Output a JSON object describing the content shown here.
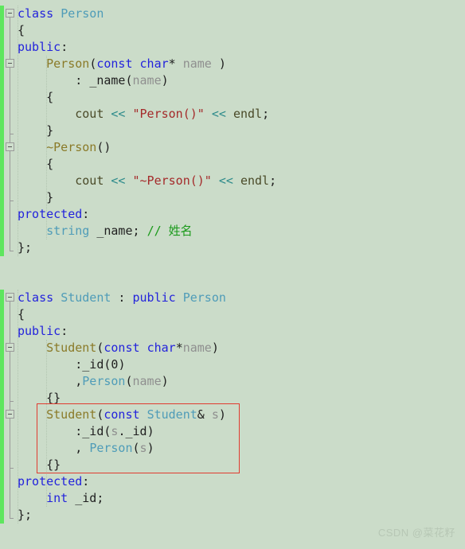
{
  "editor": {
    "background_color": "#cbdcc9",
    "change_bar_color": "#5ee65e",
    "annotation_box_color": "#e03b2f",
    "language": "C++"
  },
  "watermark": {
    "text": "CSDN @菜花籽"
  },
  "code": {
    "lines": [
      {
        "n": 1,
        "indent": 0,
        "tokens": [
          {
            "t": "class",
            "c": "kw"
          },
          {
            "t": " ",
            "c": "plain"
          },
          {
            "t": "Person",
            "c": "type"
          }
        ]
      },
      {
        "n": 2,
        "indent": 0,
        "tokens": [
          {
            "t": "{",
            "c": "plain"
          }
        ]
      },
      {
        "n": 3,
        "indent": 0,
        "tokens": [
          {
            "t": "public",
            "c": "kw"
          },
          {
            "t": ":",
            "c": "plain"
          }
        ]
      },
      {
        "n": 4,
        "indent": 0,
        "tokens": [
          {
            "t": "    ",
            "c": "plain"
          },
          {
            "t": "Person",
            "c": "fn"
          },
          {
            "t": "(",
            "c": "plain"
          },
          {
            "t": "const",
            "c": "kw"
          },
          {
            "t": " ",
            "c": "plain"
          },
          {
            "t": "char",
            "c": "kw"
          },
          {
            "t": "*",
            "c": "plain"
          },
          {
            "t": " ",
            "c": "plain"
          },
          {
            "t": "name",
            "c": "var"
          },
          {
            "t": " )",
            "c": "plain"
          }
        ]
      },
      {
        "n": 5,
        "indent": 0,
        "tokens": [
          {
            "t": "        : ",
            "c": "plain"
          },
          {
            "t": "_name",
            "c": "plain"
          },
          {
            "t": "(",
            "c": "plain"
          },
          {
            "t": "name",
            "c": "var"
          },
          {
            "t": ")",
            "c": "plain"
          }
        ]
      },
      {
        "n": 6,
        "indent": 0,
        "tokens": [
          {
            "t": "    {",
            "c": "plain"
          }
        ]
      },
      {
        "n": 7,
        "indent": 0,
        "tokens": [
          {
            "t": "        ",
            "c": "plain"
          },
          {
            "t": "cout",
            "c": "id"
          },
          {
            "t": " ",
            "c": "plain"
          },
          {
            "t": "<<",
            "c": "op"
          },
          {
            "t": " ",
            "c": "plain"
          },
          {
            "t": "\"Person()\"",
            "c": "str"
          },
          {
            "t": " ",
            "c": "plain"
          },
          {
            "t": "<<",
            "c": "op"
          },
          {
            "t": " ",
            "c": "plain"
          },
          {
            "t": "endl",
            "c": "id"
          },
          {
            "t": ";",
            "c": "plain"
          }
        ]
      },
      {
        "n": 8,
        "indent": 0,
        "tokens": [
          {
            "t": "    }",
            "c": "plain"
          }
        ]
      },
      {
        "n": 9,
        "indent": 0,
        "tokens": [
          {
            "t": "    ",
            "c": "plain"
          },
          {
            "t": "~Person",
            "c": "fn"
          },
          {
            "t": "()",
            "c": "plain"
          }
        ]
      },
      {
        "n": 10,
        "indent": 0,
        "tokens": [
          {
            "t": "    {",
            "c": "plain"
          }
        ]
      },
      {
        "n": 11,
        "indent": 0,
        "tokens": [
          {
            "t": "        ",
            "c": "plain"
          },
          {
            "t": "cout",
            "c": "id"
          },
          {
            "t": " ",
            "c": "plain"
          },
          {
            "t": "<<",
            "c": "op"
          },
          {
            "t": " ",
            "c": "plain"
          },
          {
            "t": "\"~Person()\"",
            "c": "str"
          },
          {
            "t": " ",
            "c": "plain"
          },
          {
            "t": "<<",
            "c": "op"
          },
          {
            "t": " ",
            "c": "plain"
          },
          {
            "t": "endl",
            "c": "id"
          },
          {
            "t": ";",
            "c": "plain"
          }
        ]
      },
      {
        "n": 12,
        "indent": 0,
        "tokens": [
          {
            "t": "    }",
            "c": "plain"
          }
        ]
      },
      {
        "n": 13,
        "indent": 0,
        "tokens": [
          {
            "t": "protected",
            "c": "kw"
          },
          {
            "t": ":",
            "c": "plain"
          }
        ]
      },
      {
        "n": 14,
        "indent": 0,
        "tokens": [
          {
            "t": "    ",
            "c": "plain"
          },
          {
            "t": "string",
            "c": "type"
          },
          {
            "t": " _name; ",
            "c": "plain"
          },
          {
            "t": "// 姓名",
            "c": "cmt"
          }
        ]
      },
      {
        "n": 15,
        "indent": 0,
        "tokens": [
          {
            "t": "};",
            "c": "plain"
          }
        ]
      },
      {
        "n": 16,
        "indent": 0,
        "tokens": []
      },
      {
        "n": 17,
        "indent": 0,
        "tokens": []
      },
      {
        "n": 18,
        "indent": 0,
        "tokens": [
          {
            "t": "class",
            "c": "kw"
          },
          {
            "t": " ",
            "c": "plain"
          },
          {
            "t": "Student",
            "c": "type"
          },
          {
            "t": " : ",
            "c": "plain"
          },
          {
            "t": "public",
            "c": "kw"
          },
          {
            "t": " ",
            "c": "plain"
          },
          {
            "t": "Person",
            "c": "type"
          }
        ]
      },
      {
        "n": 19,
        "indent": 0,
        "tokens": [
          {
            "t": "{",
            "c": "plain"
          }
        ]
      },
      {
        "n": 20,
        "indent": 0,
        "tokens": [
          {
            "t": "public",
            "c": "kw"
          },
          {
            "t": ":",
            "c": "plain"
          }
        ]
      },
      {
        "n": 21,
        "indent": 0,
        "tokens": [
          {
            "t": "    ",
            "c": "plain"
          },
          {
            "t": "Student",
            "c": "fn"
          },
          {
            "t": "(",
            "c": "plain"
          },
          {
            "t": "const",
            "c": "kw"
          },
          {
            "t": " ",
            "c": "plain"
          },
          {
            "t": "char",
            "c": "kw"
          },
          {
            "t": "*",
            "c": "plain"
          },
          {
            "t": "name",
            "c": "var"
          },
          {
            "t": ")",
            "c": "plain"
          }
        ]
      },
      {
        "n": 22,
        "indent": 0,
        "tokens": [
          {
            "t": "        :",
            "c": "plain"
          },
          {
            "t": "_id",
            "c": "plain"
          },
          {
            "t": "(",
            "c": "plain"
          },
          {
            "t": "0",
            "c": "plain"
          },
          {
            "t": ")",
            "c": "plain"
          }
        ]
      },
      {
        "n": 23,
        "indent": 0,
        "tokens": [
          {
            "t": "        ,",
            "c": "plain"
          },
          {
            "t": "Person",
            "c": "type"
          },
          {
            "t": "(",
            "c": "plain"
          },
          {
            "t": "name",
            "c": "var"
          },
          {
            "t": ")",
            "c": "plain"
          }
        ]
      },
      {
        "n": 24,
        "indent": 0,
        "tokens": [
          {
            "t": "    {}",
            "c": "plain"
          }
        ]
      },
      {
        "n": 25,
        "indent": 0,
        "tokens": [
          {
            "t": "    ",
            "c": "plain"
          },
          {
            "t": "Student",
            "c": "fn"
          },
          {
            "t": "(",
            "c": "plain"
          },
          {
            "t": "const",
            "c": "kw"
          },
          {
            "t": " ",
            "c": "plain"
          },
          {
            "t": "Student",
            "c": "type"
          },
          {
            "t": "& ",
            "c": "plain"
          },
          {
            "t": "s",
            "c": "var"
          },
          {
            "t": ")",
            "c": "plain"
          }
        ]
      },
      {
        "n": 26,
        "indent": 0,
        "tokens": [
          {
            "t": "        :",
            "c": "plain"
          },
          {
            "t": "_id",
            "c": "plain"
          },
          {
            "t": "(",
            "c": "plain"
          },
          {
            "t": "s",
            "c": "var"
          },
          {
            "t": "._id",
            "c": "plain"
          },
          {
            "t": ")",
            "c": "plain"
          }
        ]
      },
      {
        "n": 27,
        "indent": 0,
        "tokens": [
          {
            "t": "        , ",
            "c": "plain"
          },
          {
            "t": "Person",
            "c": "type"
          },
          {
            "t": "(",
            "c": "plain"
          },
          {
            "t": "s",
            "c": "var"
          },
          {
            "t": ")",
            "c": "plain"
          }
        ]
      },
      {
        "n": 28,
        "indent": 0,
        "tokens": [
          {
            "t": "    {}",
            "c": "plain"
          }
        ]
      },
      {
        "n": 29,
        "indent": 0,
        "tokens": [
          {
            "t": "protected",
            "c": "kw"
          },
          {
            "t": ":",
            "c": "plain"
          }
        ]
      },
      {
        "n": 30,
        "indent": 0,
        "tokens": [
          {
            "t": "    ",
            "c": "plain"
          },
          {
            "t": "int",
            "c": "kw"
          },
          {
            "t": " _id;",
            "c": "plain"
          }
        ]
      },
      {
        "n": 31,
        "indent": 0,
        "tokens": [
          {
            "t": "};",
            "c": "plain"
          }
        ]
      }
    ]
  },
  "gutter": {
    "fold_markers": [
      {
        "name": "fold-class-person",
        "line": 1,
        "span_to_line": 15
      },
      {
        "name": "fold-person-ctor",
        "line": 4,
        "span_to_line": 8
      },
      {
        "name": "fold-person-dtor",
        "line": 9,
        "span_to_line": 12
      },
      {
        "name": "fold-class-student",
        "line": 18,
        "span_to_line": 31
      },
      {
        "name": "fold-student-ctor",
        "line": 21,
        "span_to_line": 24
      },
      {
        "name": "fold-student-copy-ctor",
        "line": 25,
        "span_to_line": 28
      }
    ],
    "change_bars": [
      {
        "from_line": 1,
        "to_line": 15
      },
      {
        "from_line": 18,
        "to_line": 31
      }
    ]
  },
  "annotations": [
    {
      "name": "student-copy-constructor-highlight",
      "from_line": 25,
      "to_line": 28,
      "color": "#e03b2f"
    }
  ]
}
